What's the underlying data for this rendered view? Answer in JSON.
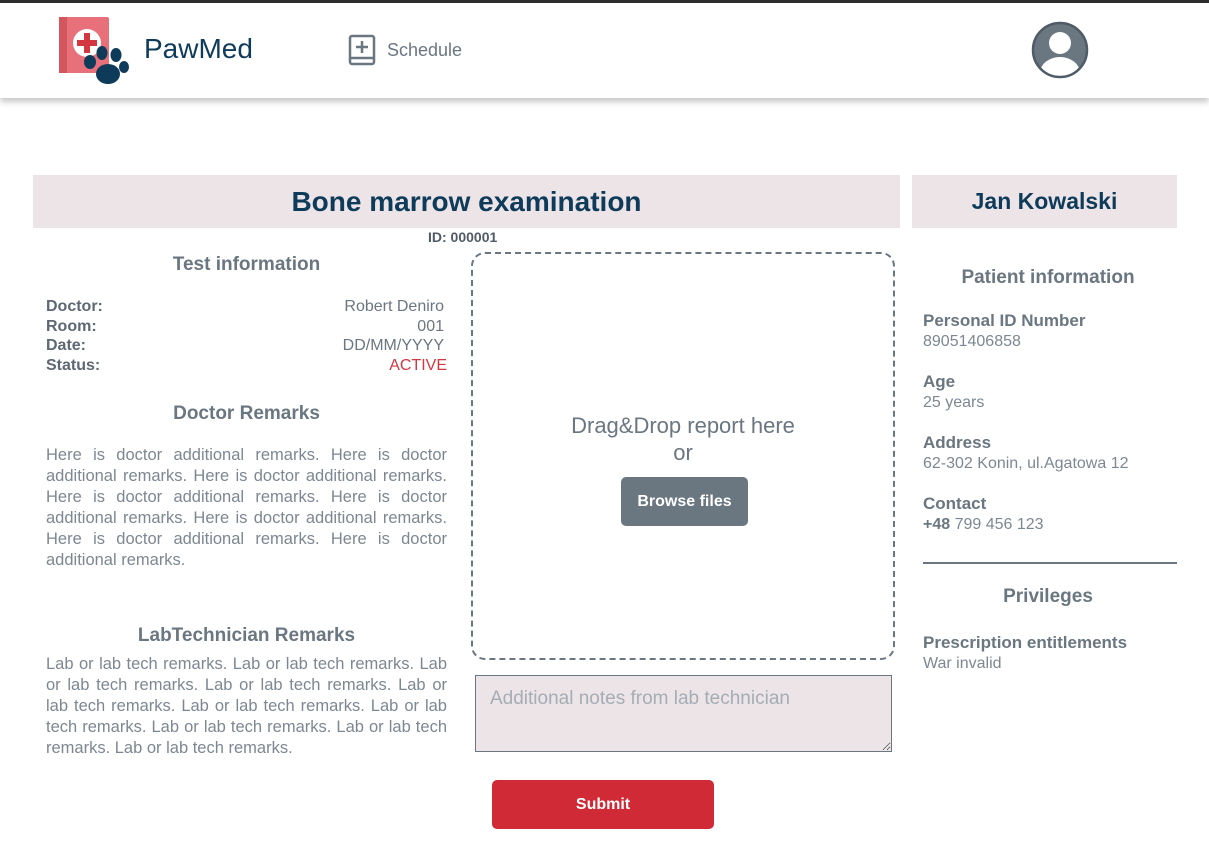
{
  "app": {
    "brand": "PawMed"
  },
  "nav": {
    "schedule_label": "Schedule"
  },
  "header": {
    "title": "Bone marrow examination",
    "test_id": "ID: 000001"
  },
  "patient": {
    "name": "Jan Kowalski",
    "section_title": "Patient information",
    "fields": [
      {
        "label": "Personal ID Number",
        "value": "89051406858"
      },
      {
        "label": "Age",
        "value": "25 years"
      },
      {
        "label": "Address",
        "value": "62-302 Konin, ul.Agatowa 12"
      }
    ],
    "contact": {
      "label": "Contact",
      "prefix": "+48",
      "number": "799 456 123"
    },
    "privileges": {
      "title": "Privileges",
      "label": "Prescription entitlements",
      "value": "War invalid"
    }
  },
  "test_info": {
    "title": "Test information",
    "rows": [
      {
        "label": "Doctor:",
        "value": "Robert Deniro"
      },
      {
        "label": "Room:",
        "value": "001"
      },
      {
        "label": "Date:",
        "value": "DD/MM/YYYY"
      },
      {
        "label": "Status:",
        "value": "ACTIVE"
      }
    ]
  },
  "doctor_remarks": {
    "title": "Doctor Remarks",
    "text": "Here is doctor additional remarks. Here is doctor additional remarks. Here is doctor additional remarks. Here is doctor additional remarks. Here is doctor additional remarks. Here is doctor additional remarks. Here is doctor additional remarks. Here is doctor additional remarks."
  },
  "lab_remarks": {
    "title": "LabTechnician  Remarks",
    "text": "Lab or lab tech remarks. Lab or lab tech remarks. Lab or lab tech remarks. Lab or lab tech remarks. Lab or lab tech remarks. Lab or lab tech remarks. Lab or lab tech remarks. Lab or lab tech remarks. Lab or lab tech remarks. Lab or lab tech remarks."
  },
  "upload": {
    "line1": "Drag&Drop report here",
    "line2": "or",
    "browse_label": "Browse files"
  },
  "notes": {
    "placeholder": "Additional notes from lab technician",
    "value": ""
  },
  "actions": {
    "submit_label": "Submit"
  },
  "colors": {
    "brand_navy": "#0f3b5a",
    "accent_red": "#cf2a35",
    "status_active": "#d23742",
    "muted": "#6a7680",
    "panel_bg": "#ece4e7"
  },
  "icons": {
    "logo": "medical-kit-paw-logo",
    "schedule": "book-plus-icon",
    "avatar": "user-avatar-icon"
  }
}
